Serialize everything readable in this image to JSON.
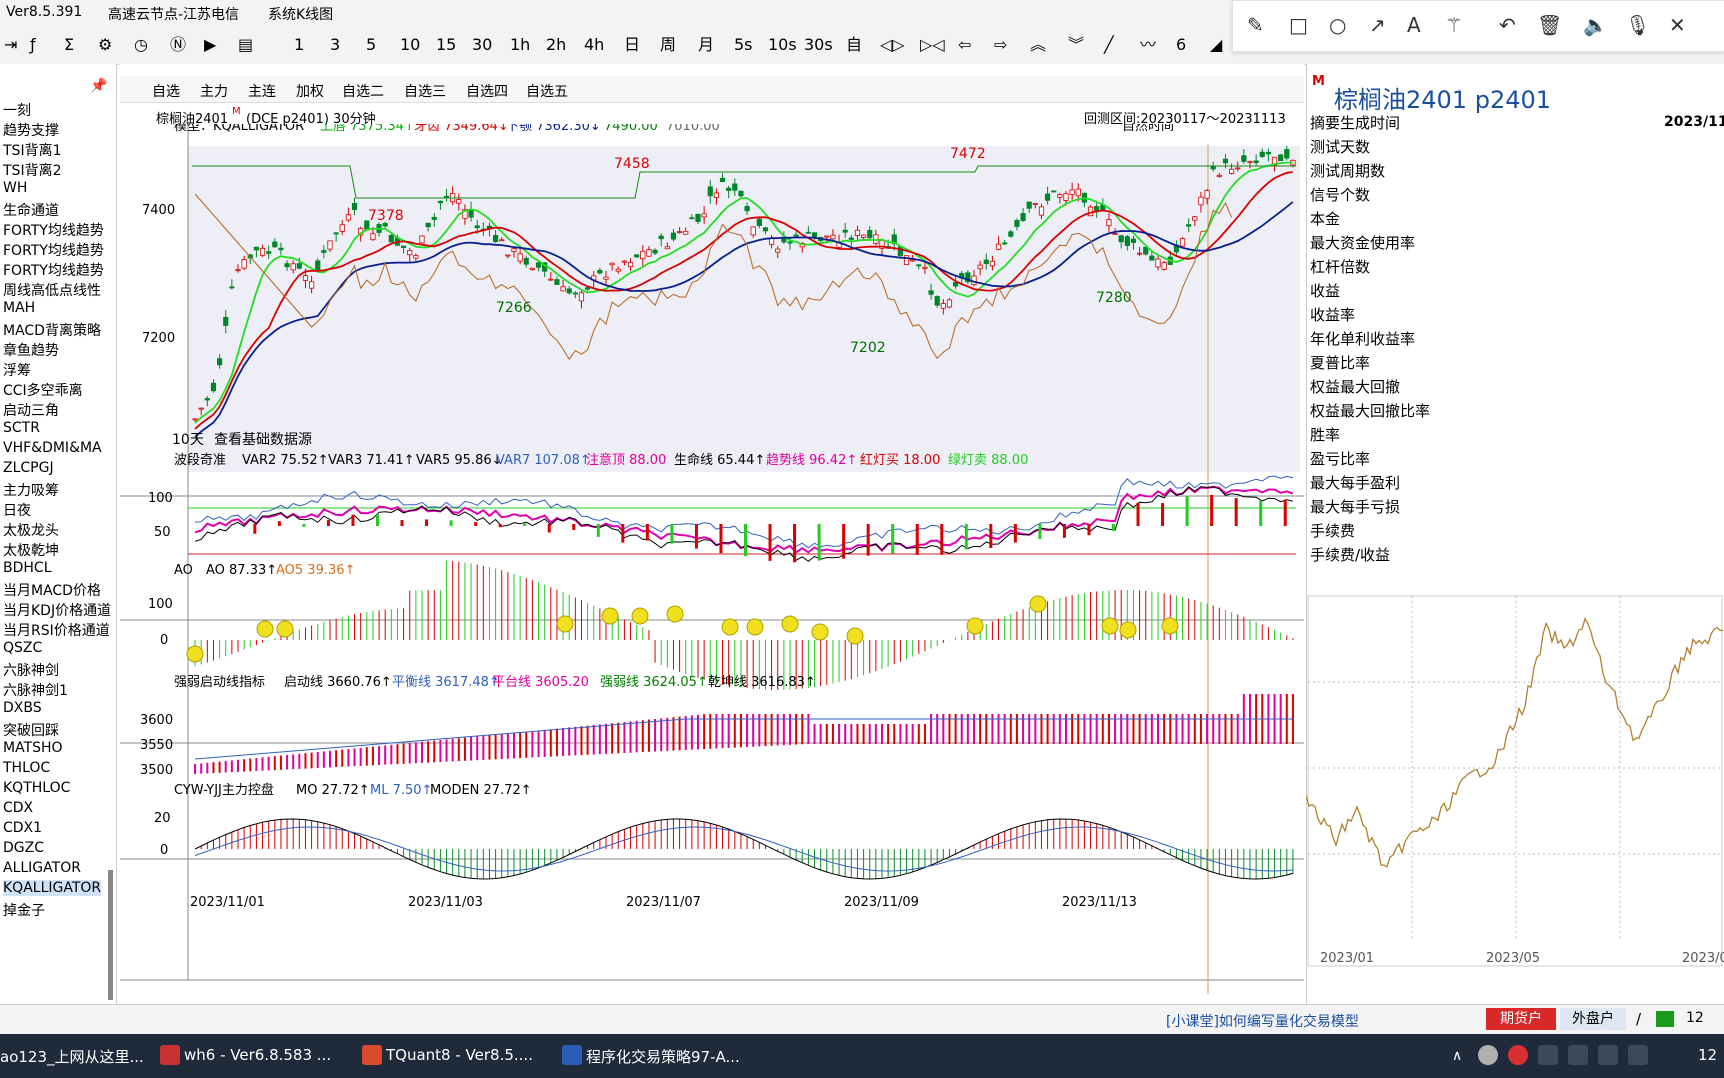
{
  "titlebar": {
    "version": "Ver8.5.391",
    "server": "高速云节点-江苏电信",
    "view": "系统K线图"
  },
  "toolbar": {
    "periods": [
      "1",
      "3",
      "5",
      "10",
      "15",
      "30",
      "1h",
      "2h",
      "4h",
      "日",
      "周",
      "月",
      "5s",
      "10s",
      "30s",
      "自"
    ]
  },
  "sidebar": {
    "pin_icon": "pin-icon",
    "items": [
      "一刻",
      "趋势支撑",
      "TSI背离1",
      "TSI背离2",
      "WH",
      "生命通道",
      "FORTY均线趋势",
      "FORTY均线趋势",
      "FORTY均线趋势",
      "周线高低点线性",
      "MAH",
      "MACD背离策略",
      "章鱼趋势",
      "浮筹",
      "CCI多空乖离",
      "启动三角",
      "SCTR",
      "VHF&DMI&MA",
      "ZLCPGJ",
      "主力吸筹",
      "日夜",
      "太极龙头",
      "太极乾坤",
      "BDHCL",
      "当月MACD价格",
      "当月KDJ价格通道",
      "当月RSI价格通道",
      "QSZC",
      "六脉神剑",
      "六脉神剑1",
      "DXBS",
      "突破回踩",
      "MATSHO",
      "THLOC",
      "KQTHLOC",
      "CDX",
      "CDX1",
      "DGZC",
      "ALLIGATOR",
      "KQALLIGATOR",
      "掉金子"
    ],
    "selected_index": 39
  },
  "tabs": [
    "自选",
    "主力",
    "主连",
    "加权",
    "自选二",
    "自选三",
    "自选四",
    "自选五"
  ],
  "chart_header": {
    "instrument": "棕榈油2401",
    "marker": "M",
    "code": "(DCE  p2401) 30分钟",
    "range": "回测区间:20230117～20231113",
    "time_mode": "自然时间"
  },
  "main_panel": {
    "model_label": "模型：KQALLIGATOR",
    "upper": "上唇 7375.34↑",
    "teeth": "牙齿 7349.64↓",
    "jaw": "下颚 7362.30↓",
    "v1": "7490.00",
    "v2": "7010.00",
    "y_ticks": [
      "7400",
      "7200"
    ],
    "annotations": [
      "7458",
      "7472",
      "7378",
      "7266",
      "7202",
      "7280"
    ],
    "footer": "10天",
    "footer_link": "查看基础数据源"
  },
  "panel2": {
    "name": "波段奇准",
    "items": [
      "VAR2 75.52↑",
      "VAR3 71.41↑",
      "VAR5 95.86↓",
      "VAR7 107.08↑",
      "注意顶 88.00",
      "生命线 65.44↑",
      "趋势线 96.42↑",
      "红灯买 18.00",
      "绿灯卖 88.00"
    ],
    "y_ticks": [
      "100",
      "50"
    ]
  },
  "panel3": {
    "name": "AO",
    "items": [
      "AO 87.33↑",
      "AO5 39.36↑"
    ],
    "y_ticks": [
      "100",
      "0"
    ]
  },
  "panel4": {
    "name": "强弱启动线指标",
    "items": [
      "启动线 3660.76↑",
      "平衡线 3617.48↑",
      "平台线 3605.20",
      "强弱线 3624.05↑",
      "乾坤线 3616.83↑"
    ],
    "y_ticks": [
      "3600",
      "3550",
      "3500"
    ]
  },
  "panel5": {
    "name": "CYW-YJJ主力控盘",
    "items": [
      "MO 27.72↑",
      "ML 7.50↑",
      "MODEN 27.72↑"
    ],
    "y_ticks": [
      "20",
      "0"
    ]
  },
  "x_axis": [
    "2023/11/01",
    "2023/11/03",
    "2023/11/07",
    "2023/11/09",
    "2023/11/13"
  ],
  "right_panel": {
    "title": "棕榈油2401  p2401",
    "marker": "M",
    "rows": [
      "摘要生成时间",
      "测试天数",
      "测试周期数",
      "信号个数",
      "本金",
      "最大资金使用率",
      "杠杆倍数",
      "收益",
      "收益率",
      "年化单利收益率",
      "夏普比率",
      "权益最大回撤",
      "权益最大回撤比率",
      "胜率",
      "盈亏比率",
      "最大每手盈利",
      "最大每手亏损",
      "手续费",
      "手续费/收益"
    ],
    "first_value": "2023/11/",
    "equity_x": [
      "2023/01",
      "2023/05",
      "2023/0"
    ]
  },
  "status": {
    "link": "[小课堂]如何编写量化交易模型",
    "btn_futures": "期货户",
    "btn_outer": "外盘户",
    "num": "12"
  },
  "taskbar": {
    "items": [
      "ao123_上网从这里...",
      "wh6 - Ver6.8.583 ...",
      "TQuant8 - Ver8.5....",
      "程序化交易策略97-A..."
    ],
    "clock": "12"
  },
  "colors": {
    "red": "#d80000",
    "green": "#00a800",
    "navy": "#0a1f8f",
    "brown": "#b5651d",
    "magenta": "#e0009c",
    "lime": "#22dd22"
  }
}
